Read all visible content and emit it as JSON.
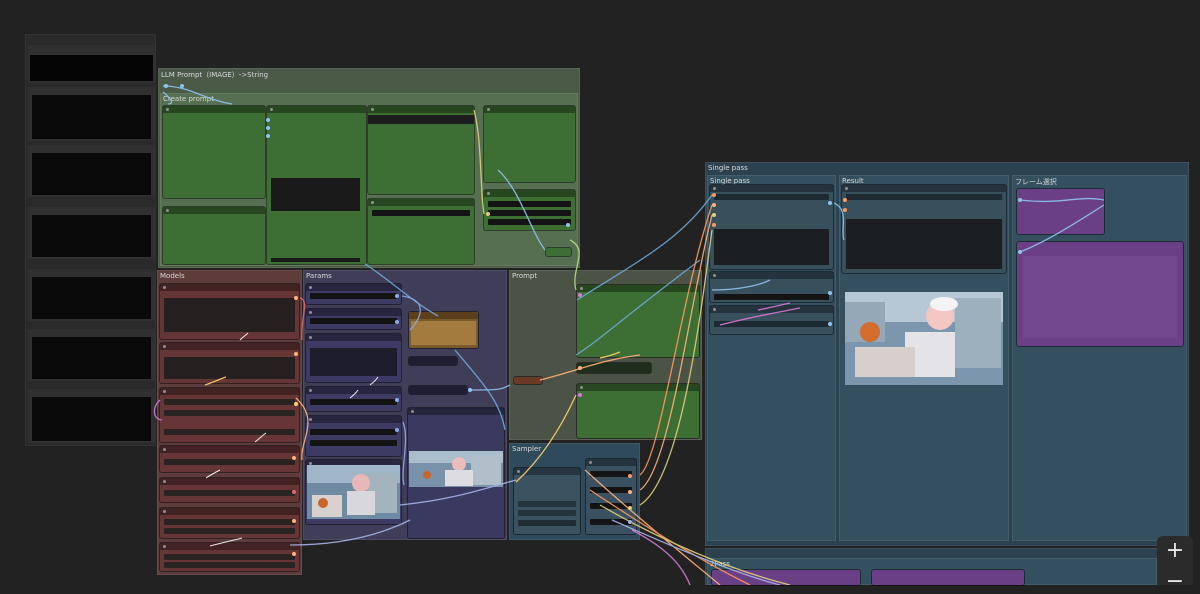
{
  "groups": {
    "llm_prompt": "LLM Prompt（IMAGE）->String",
    "create_prompt": "Create prompt",
    "models": "Models",
    "params": "Params",
    "prompt": "Prompt",
    "sampler": "Sampler",
    "single_pass": "Single pass",
    "single_pass_sub": "Single pass",
    "result": "Result",
    "frame_note": "フレーム選択",
    "bottom_sub": "2Pass"
  },
  "canvas": {
    "zoom_in_label": "+",
    "zoom_out_label": "−"
  },
  "colors": {
    "green_group": "#4a5d44",
    "models_group": "#5e3c3c",
    "params_group": "#3f3d58",
    "blue_group": "#2c4250",
    "purple_node": "#6b3f86"
  },
  "icons": [
    "plus-icon",
    "minus-icon"
  ]
}
